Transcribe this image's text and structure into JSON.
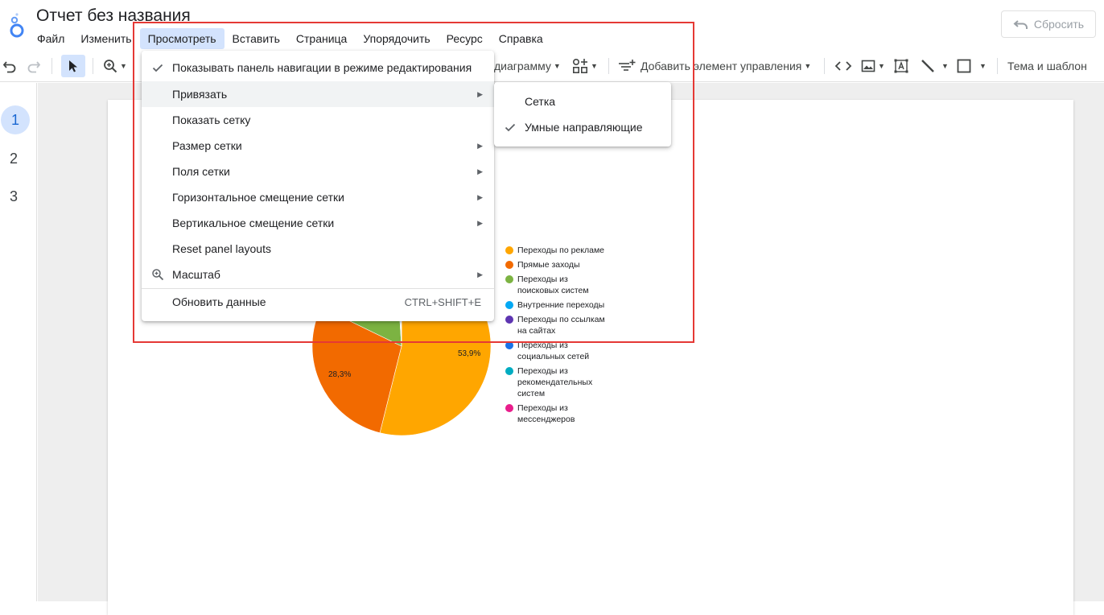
{
  "app": {
    "title": "Отчет без названия",
    "reset_label": "Сбросить"
  },
  "menubar": [
    "Файл",
    "Изменить",
    "Просмотреть",
    "Вставить",
    "Страница",
    "Упорядочить",
    "Ресурс",
    "Справка"
  ],
  "toolbar": {
    "add_chart_label": "диаграмму",
    "add_control_label": "Добавить элемент управления",
    "theme_label": "Тема и шаблон"
  },
  "pages": [
    "1",
    "2",
    "3"
  ],
  "view_menu": {
    "items": [
      {
        "label": "Показывать панель навигации в режиме редактирования",
        "checked": true,
        "submenu": false
      },
      {
        "label": "Привязать",
        "checked": false,
        "submenu": true
      },
      {
        "label": "Показать сетку",
        "checked": false,
        "submenu": false
      },
      {
        "label": "Размер сетки",
        "checked": false,
        "submenu": true
      },
      {
        "label": "Поля сетки",
        "checked": false,
        "submenu": true
      },
      {
        "label": "Горизонтальное смещение сетки",
        "checked": false,
        "submenu": true
      },
      {
        "label": "Вертикальное смещение сетки",
        "checked": false,
        "submenu": true
      },
      {
        "label": "Reset panel layouts",
        "checked": false,
        "submenu": false
      },
      {
        "label": "Масштаб",
        "checked": false,
        "submenu": true,
        "icon": "zoom-icon"
      },
      {
        "label": "Обновить данные",
        "checked": false,
        "submenu": false,
        "shortcut": "CTRL+SHIFT+E"
      }
    ]
  },
  "snap_submenu": {
    "items": [
      {
        "label": "Сетка",
        "checked": false
      },
      {
        "label": "Умные направляющие",
        "checked": true
      }
    ]
  },
  "colors": {
    "accent": "#1a73e8",
    "menu_active": "#d3e3fd",
    "highlight": "#e53935"
  },
  "chart_data": {
    "type": "pie",
    "series": [
      {
        "name": "Переходы по рекламе",
        "value": 53.9,
        "label": "53,9%",
        "color": "#ffa600"
      },
      {
        "name": "Прямые заходы",
        "value": 28.3,
        "label": "28,3%",
        "color": "#f26a00"
      },
      {
        "name": "Переходы из поисковых систем",
        "value": 16.8,
        "color": "#7cb342"
      },
      {
        "name": "Внутренние переходы",
        "value": 0.4,
        "color": "#03a9f4"
      },
      {
        "name": "Переходы по ссылкам на сайтах",
        "value": 0.3,
        "color": "#5e35b1"
      },
      {
        "name": "Переходы из социальных сетей",
        "value": 0.2,
        "color": "#1a73e8"
      },
      {
        "name": "Переходы из рекомендательных систем",
        "value": 0.07,
        "color": "#00acc1"
      },
      {
        "name": "Переходы из мессенджеров",
        "value": 0.03,
        "color": "#e91e8c"
      }
    ],
    "legend_position": "right"
  }
}
